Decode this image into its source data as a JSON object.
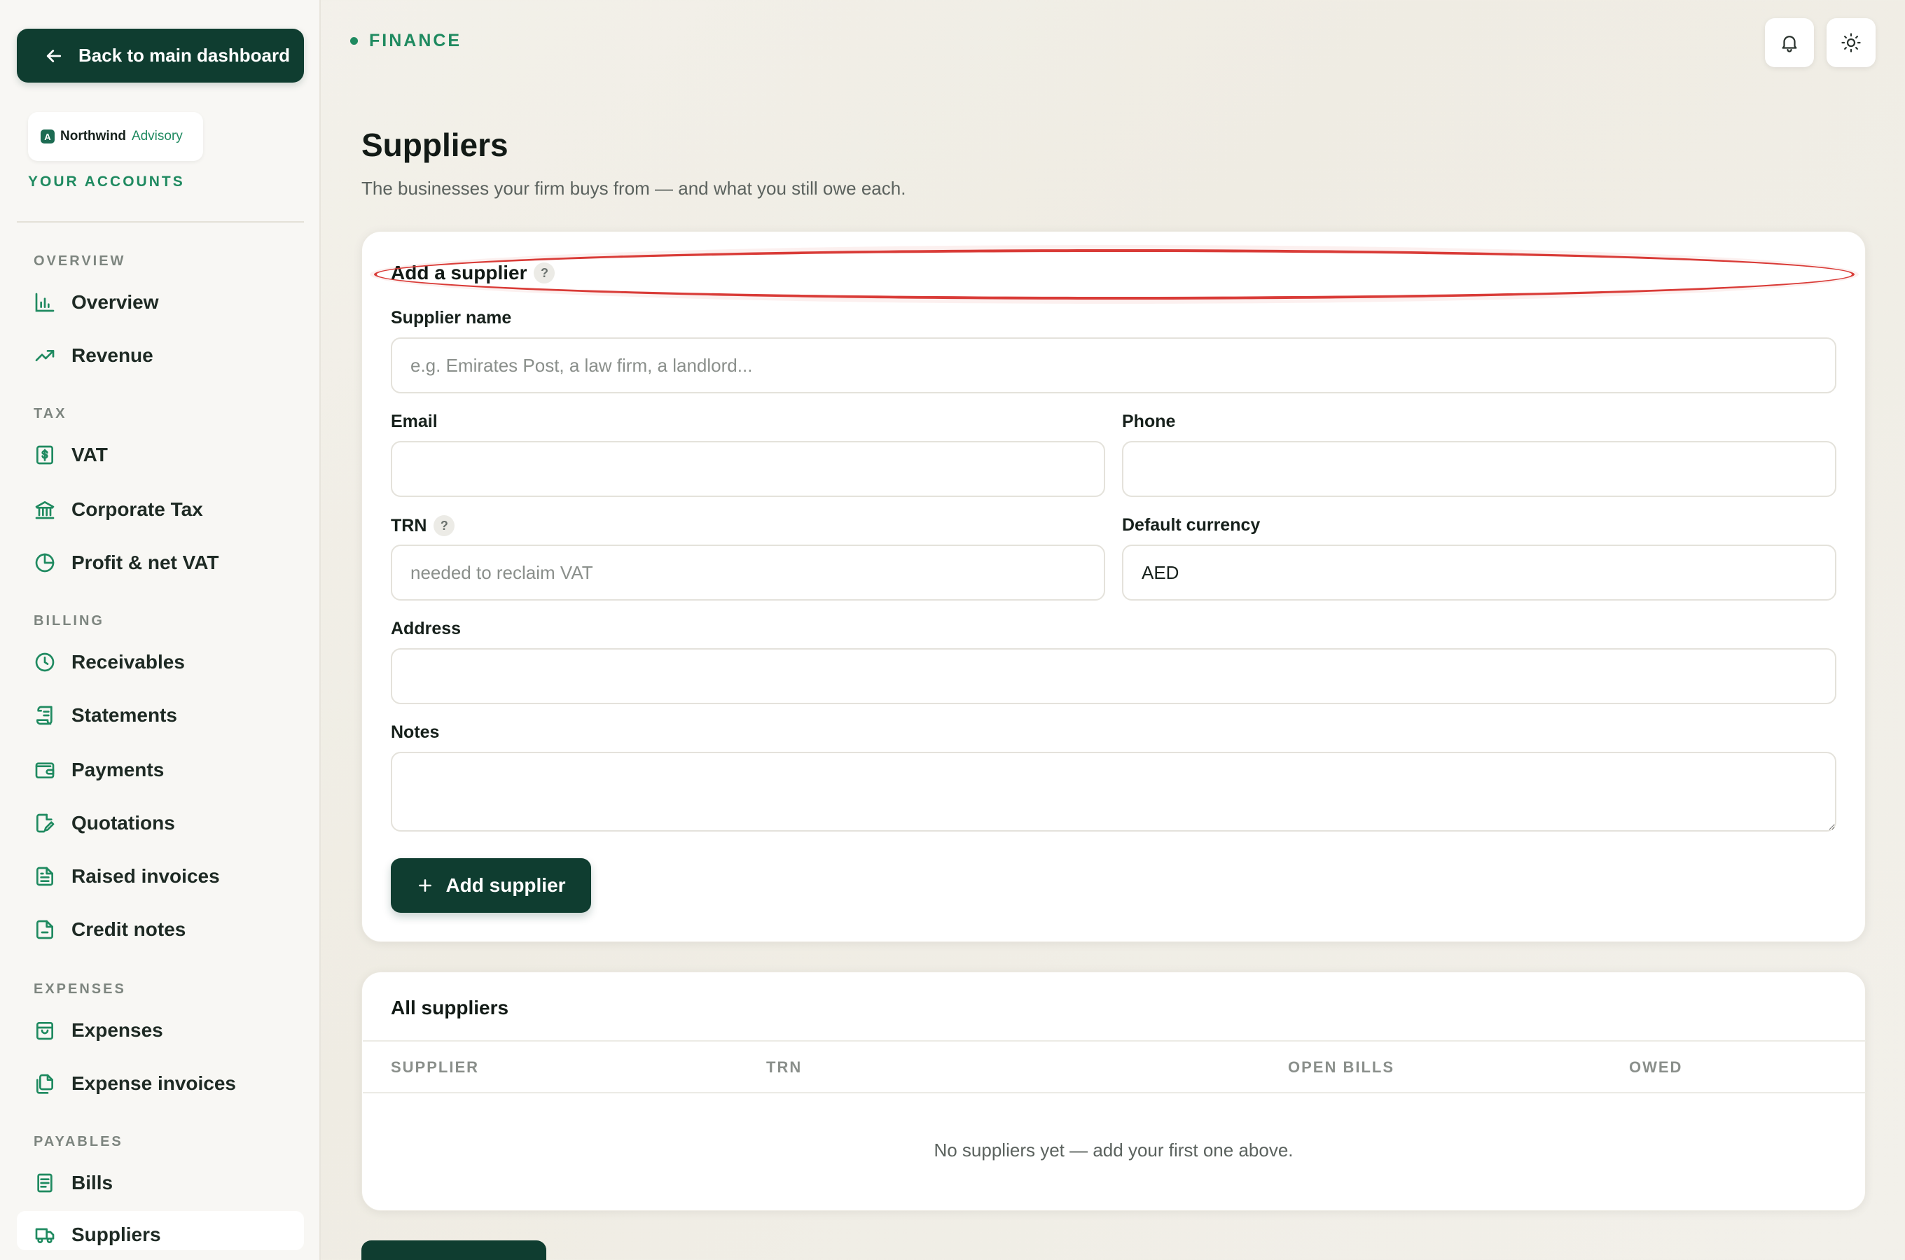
{
  "sidebar": {
    "back_label": "Back to main dashboard",
    "org_name": "Northwind",
    "org_tag": "Advisory",
    "org_logo_letter": "A",
    "accounts_label": "YOUR ACCOUNTS",
    "sections": {
      "overview": "OVERVIEW",
      "tax": "TAX",
      "billing": "BILLING",
      "expenses": "EXPENSES",
      "payables": "PAYABLES"
    },
    "items": {
      "overview": "Overview",
      "revenue": "Revenue",
      "vat": "VAT",
      "corporate_tax": "Corporate Tax",
      "profit_vat": "Profit & net VAT",
      "receivables": "Receivables",
      "statements": "Statements",
      "payments": "Payments",
      "quotations": "Quotations",
      "raised_invoices": "Raised invoices",
      "credit_notes": "Credit notes",
      "expenses": "Expenses",
      "expense_invoices": "Expense invoices",
      "bills": "Bills",
      "suppliers": "Suppliers"
    },
    "active_item": "suppliers"
  },
  "topbar": {
    "crumb": "FINANCE",
    "icons": [
      "bell-icon",
      "sun-icon"
    ]
  },
  "page": {
    "title": "Suppliers",
    "subtitle": "The businesses your firm buys from — and what you still owe each."
  },
  "form": {
    "title": "Add a supplier",
    "help_glyph": "?",
    "supplier_name_label": "Supplier name",
    "supplier_name_placeholder": "e.g. Emirates Post, a law firm, a landlord...",
    "email_label": "Email",
    "email_value": "",
    "phone_label": "Phone",
    "phone_value": "",
    "trn_label": "TRN",
    "trn_placeholder": "needed to reclaim VAT",
    "currency_label": "Default currency",
    "currency_value": "AED",
    "address_label": "Address",
    "address_value": "",
    "notes_label": "Notes",
    "notes_value": "",
    "submit_label": "Add supplier"
  },
  "list": {
    "title": "All suppliers",
    "columns": [
      "SUPPLIER",
      "TRN",
      "OPEN BILLS",
      "OWED"
    ],
    "rows": [],
    "empty_text": "No suppliers yet — add your first one above."
  },
  "colors": {
    "brand_dark": "#0f3d30",
    "accent_green": "#1f8a60",
    "highlight_red": "#d93b37"
  }
}
